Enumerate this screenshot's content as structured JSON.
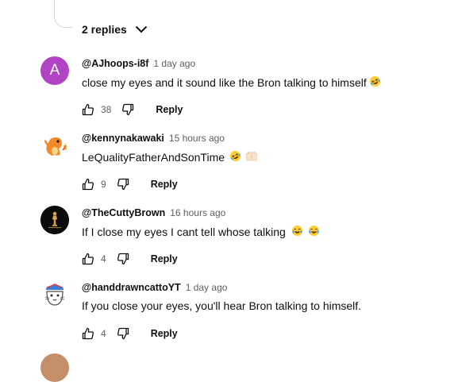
{
  "thread": {
    "replies_label": "2 replies"
  },
  "comments": [
    {
      "author": "@AJhoops-i8f",
      "time": "1 day ago",
      "text": "close my eyes and it sound like the Bron talking to himself",
      "avatar_letter": "A",
      "avatar_color": "#b143c5",
      "emojis": [
        "rolling-on-floor-laughing"
      ],
      "likes": "38",
      "reply_label": "Reply"
    },
    {
      "author": "@kennynakawaki",
      "time": "15 hours ago",
      "text": "LeQualityFatherAndSonTime",
      "avatar_icon": "charmander-avatar",
      "emojis": [
        "rolling-on-floor-laughing",
        "raising-hands"
      ],
      "likes": "9",
      "reply_label": "Reply"
    },
    {
      "author": "@TheCuttyBrown",
      "time": "16 hours ago",
      "text": "If I close my eyes I cant tell whose talking",
      "avatar_icon": "trophy-avatar",
      "emojis": [
        "tears-of-joy",
        "tears-of-joy"
      ],
      "likes": "4",
      "reply_label": "Reply"
    },
    {
      "author": "@handdrawncattoYT",
      "time": "1 day ago",
      "text": "If you close your eyes, you'll hear Bron talking to himself.",
      "avatar_icon": "cat-avatar",
      "emojis": [],
      "likes": "4",
      "reply_label": "Reply"
    }
  ]
}
